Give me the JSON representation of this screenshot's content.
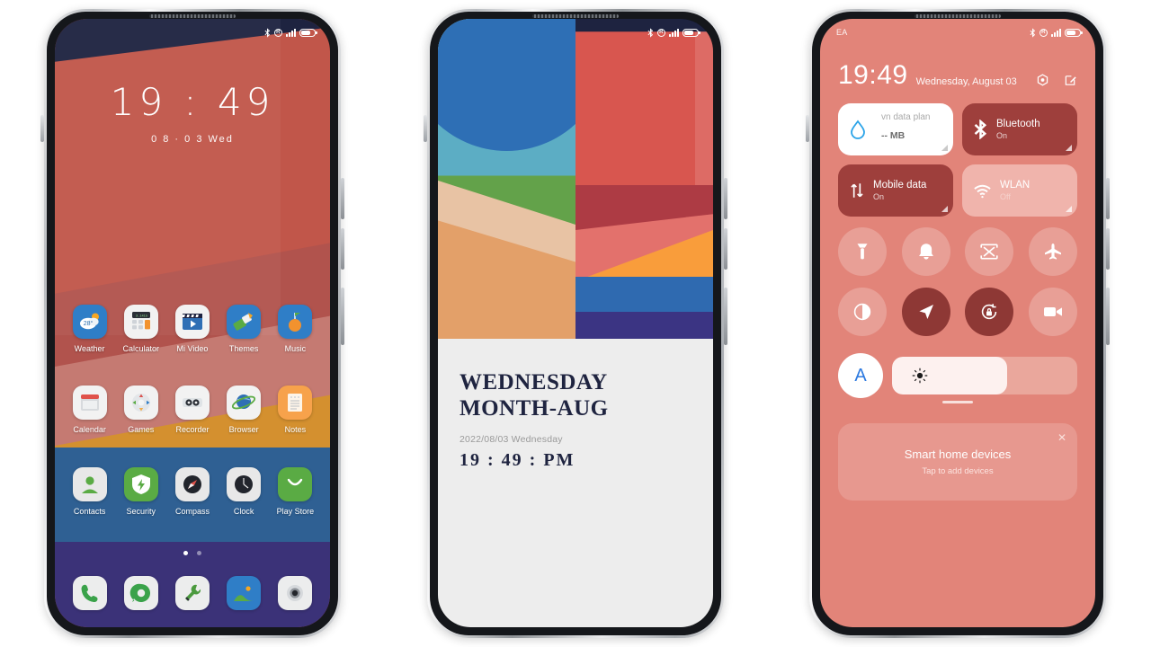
{
  "phone1": {
    "name": "home-screen",
    "status_bar": {
      "bluetooth": "bluetooth-icon",
      "roaming": "R",
      "signal": "signal-icon",
      "battery": "battery-icon"
    },
    "clock": {
      "time": "19 : 49",
      "date": "0 8 · 0 3  Wed"
    },
    "app_rows": [
      [
        {
          "label": "Weather",
          "icon": "weather-icon",
          "bg": "#2f7ec7"
        },
        {
          "label": "Calculator",
          "icon": "calculator-icon",
          "bg": "#f2f2f2"
        },
        {
          "label": "Mi Video",
          "icon": "video-icon",
          "bg": "#f2f2f2"
        },
        {
          "label": "Themes",
          "icon": "themes-icon",
          "bg": "#2f7ec7"
        },
        {
          "label": "Music",
          "icon": "music-icon",
          "bg": "#2f7ec7"
        }
      ],
      [
        {
          "label": "Calendar",
          "icon": "calendar-icon",
          "bg": "#f2f2f2"
        },
        {
          "label": "Games",
          "icon": "games-icon",
          "bg": "#f2f2f2"
        },
        {
          "label": "Recorder",
          "icon": "recorder-icon",
          "bg": "#f2f2f2"
        },
        {
          "label": "Browser",
          "icon": "browser-icon",
          "bg": "#f2f2f2"
        },
        {
          "label": "Notes",
          "icon": "notes-icon",
          "bg": "#f7a24b"
        }
      ],
      [
        {
          "label": "Contacts",
          "icon": "contacts-icon",
          "bg": "#e8e8e8"
        },
        {
          "label": "Security",
          "icon": "security-icon",
          "bg": "#5aab44"
        },
        {
          "label": "Compass",
          "icon": "compass-icon",
          "bg": "#e8e8e8"
        },
        {
          "label": "Clock",
          "icon": "clock-icon",
          "bg": "#e8e8e8"
        },
        {
          "label": "Play Store",
          "icon": "play-store-icon",
          "bg": "#5aab44"
        }
      ]
    ],
    "page_dots": {
      "count": 2,
      "active": 0
    },
    "dock": [
      {
        "label": "Phone",
        "icon": "phone-icon",
        "bg": "#eceded"
      },
      {
        "label": "Messages",
        "icon": "messages-icon",
        "bg": "#eceded"
      },
      {
        "label": "Tools",
        "icon": "tools-icon",
        "bg": "#eceded"
      },
      {
        "label": "Gallery",
        "icon": "gallery-icon",
        "bg": "#2f7ec7"
      },
      {
        "label": "Camera",
        "icon": "camera-icon",
        "bg": "#eceded"
      }
    ]
  },
  "phone2": {
    "name": "lock-screen",
    "status_bar": {
      "bluetooth": "bluetooth-icon",
      "roaming": "R",
      "signal": "signal-icon",
      "battery": "battery-icon"
    },
    "headline_line1": "WEDNESDAY",
    "headline_line2": "MONTH-AUG",
    "subline": "2022/08/03 Wednesday",
    "time": "19 : 49 : PM"
  },
  "phone3": {
    "name": "control-center",
    "status_bar": {
      "carrier": "EA",
      "bluetooth": "bluetooth-icon",
      "roaming": "R",
      "signal": "signal-icon",
      "battery": "battery-icon"
    },
    "header": {
      "time": "19:49",
      "date": "Wednesday, August 03",
      "settings_icon": "settings-gear-icon",
      "edit_icon": "edit-pencil-icon"
    },
    "tiles": [
      {
        "name": "data-plan-tile",
        "style": "white",
        "icon": "water-drop-icon",
        "top_text": "vn data plan",
        "value": "-- MB",
        "title": "",
        "sub": ""
      },
      {
        "name": "bluetooth-tile",
        "style": "dark",
        "icon": "bluetooth-icon",
        "title": "Bluetooth",
        "sub": "On"
      },
      {
        "name": "mobile-data-tile",
        "style": "dark",
        "icon": "mobile-data-icon",
        "title": "Mobile data",
        "sub": "On"
      },
      {
        "name": "wlan-tile",
        "style": "light",
        "icon": "wifi-icon",
        "title": "WLAN",
        "sub": "Off"
      }
    ],
    "toggles": [
      {
        "name": "flashlight-toggle",
        "icon": "flashlight-icon",
        "on": false
      },
      {
        "name": "ringer-toggle",
        "icon": "bell-icon",
        "on": false
      },
      {
        "name": "screenshot-toggle",
        "icon": "screenshot-icon",
        "on": false
      },
      {
        "name": "airplane-mode-toggle",
        "icon": "airplane-icon",
        "on": false
      },
      {
        "name": "dark-mode-toggle",
        "icon": "contrast-icon",
        "on": false
      },
      {
        "name": "location-toggle",
        "icon": "location-arrow-icon",
        "on": true
      },
      {
        "name": "rotation-lock-toggle",
        "icon": "rotation-lock-icon",
        "on": true
      },
      {
        "name": "screen-record-toggle",
        "icon": "video-camera-icon",
        "on": false
      }
    ],
    "brightness": {
      "auto_label": "A",
      "icon": "brightness-sun-icon",
      "level": 62
    },
    "smart_home": {
      "title": "Smart home devices",
      "subtitle": "Tap to add devices",
      "close_icon": "close-icon"
    }
  }
}
